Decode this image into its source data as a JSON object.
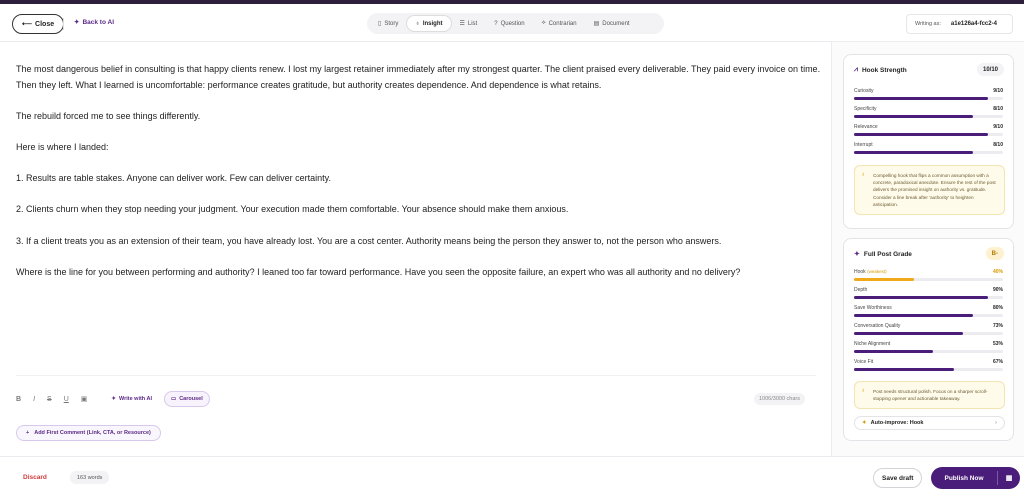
{
  "header": {
    "close_label": "Close",
    "close_arrow": "⟵",
    "back_ai_label": "Back to AI",
    "tabs": [
      {
        "icon": "▯",
        "label": "Story",
        "active": false
      },
      {
        "icon": "♁",
        "label": "Insight",
        "active": true
      },
      {
        "icon": "☰",
        "label": "List",
        "active": false
      },
      {
        "icon": "?",
        "label": "Question",
        "active": false
      },
      {
        "icon": "⟡",
        "label": "Contrarian",
        "active": false
      },
      {
        "icon": "▤",
        "label": "Document",
        "active": false
      }
    ],
    "writing_as_label": "Writing as:",
    "writing_as_value": "a1e126a4-fcc2-4"
  },
  "editor": {
    "paragraphs": [
      "The most dangerous belief in consulting is that happy clients renew. I lost my largest retainer immediately after my strongest quarter. The client praised every deliverable. They paid every invoice on time. Then they left. What I learned is uncomfortable: performance creates gratitude, but authority creates dependence. And dependence is what retains.",
      "The rebuild forced me to see things differently.",
      "Here is where I landed:",
      "1. Results are table stakes. Anyone can deliver work. Few can deliver certainty.",
      "2. Clients churn when they stop needing your judgment. Your execution made them comfortable. Your absence should make them anxious.",
      "3. If a client treats you as an extension of their team, you have already lost. You are a cost center. Authority means being the person they answer to, not the person who answers.",
      "Where is the line for you between performing and authority? I leaned too far toward performance. Have you seen the opposite failure, an expert who was all authority and no delivery?"
    ]
  },
  "toolbar": {
    "bold": "B",
    "italic": "I",
    "strike": "S",
    "underline": "U",
    "image_icon": "▣",
    "write_ai_label": "Write with AI",
    "carousel_label": "Carousel",
    "char_count": "1006/3000 chars"
  },
  "add_comment_label": "Add First Comment (Link, CTA, or Resource)",
  "hook_strength": {
    "title": "Hook Strength",
    "score": "10/10",
    "metrics": [
      {
        "label": "Curiosity",
        "value": "9/10",
        "fraction": 0.9
      },
      {
        "label": "Specificity",
        "value": "8/10",
        "fraction": 0.8
      },
      {
        "label": "Relevance",
        "value": "9/10",
        "fraction": 0.9
      },
      {
        "label": "Interrupt",
        "value": "8/10",
        "fraction": 0.8
      }
    ],
    "note": "Compelling hook that flips a common assumption with a concrete, paradoxical anecdote. Ensure the rest of the post delivers the promised insight on authority vs. gratitude. Consider a line break after 'authority' to heighten anticipation."
  },
  "post_grade": {
    "title": "Full Post Grade",
    "grade": "B-",
    "metrics": [
      {
        "label": "Hook",
        "tag": "(weakest)",
        "value": "40%",
        "fraction": 0.4,
        "warn": true
      },
      {
        "label": "Depth",
        "tag": "",
        "value": "90%",
        "fraction": 0.9,
        "warn": false
      },
      {
        "label": "Save Worthiness",
        "tag": "",
        "value": "80%",
        "fraction": 0.8,
        "warn": false
      },
      {
        "label": "Conversation Quality",
        "tag": "",
        "value": "73%",
        "fraction": 0.73,
        "warn": false
      },
      {
        "label": "Niche Alignment",
        "tag": "",
        "value": "53%",
        "fraction": 0.53,
        "warn": false
      },
      {
        "label": "Voice Fit",
        "tag": "",
        "value": "67%",
        "fraction": 0.67,
        "warn": false
      }
    ],
    "note": "Post needs structural polish. Focus on a sharper scroll-stopping opener and actionable takeaway.",
    "auto_improve_label": "Auto-improve: Hook"
  },
  "footer": {
    "discard_label": "Discard",
    "word_count": "163 words",
    "save_draft_label": "Save draft",
    "publish_label": "Publish Now"
  },
  "colors": {
    "accent": "#4a1d7a",
    "warn": "#f0a91a",
    "danger": "#d23a3a"
  }
}
